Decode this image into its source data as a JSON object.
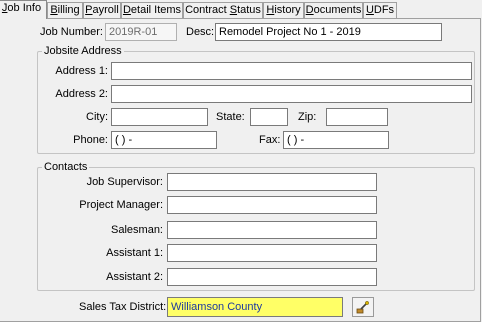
{
  "tabs": [
    {
      "pre": "",
      "key": "J",
      "post": "ob Info",
      "display": "Job Info"
    },
    {
      "pre": "",
      "key": "B",
      "post": "illing"
    },
    {
      "pre": "",
      "key": "P",
      "post": "ayroll"
    },
    {
      "pre": "",
      "key": "D",
      "post": "etail Items"
    },
    {
      "pre": "Contract ",
      "key": "S",
      "post": "tatus"
    },
    {
      "pre": "",
      "key": "H",
      "post": "istory"
    },
    {
      "pre": "",
      "key": "D",
      "post": "ocuments"
    },
    {
      "pre": "",
      "key": "U",
      "post": "DFs"
    }
  ],
  "job": {
    "number_label": "Job Number:",
    "number_value": "2019R-01",
    "desc_label": "Desc:",
    "desc_value": "Remodel Project No 1 - 2019"
  },
  "jobsite": {
    "legend": "Jobsite Address",
    "address1_label": "Address 1:",
    "address2_label": "Address 2:",
    "city_label": "City:",
    "state_label": "State:",
    "zip_label": "Zip:",
    "phone_label": "Phone:",
    "phone_value": "(   )    -",
    "fax_label": "Fax:",
    "fax_value": "(   )    -"
  },
  "contacts": {
    "legend": "Contacts",
    "supervisor_label": "Job Supervisor:",
    "manager_label": "Project Manager:",
    "salesman_label": "Salesman:",
    "assistant1_label": "Assistant 1:",
    "assistant2_label": "Assistant 2:"
  },
  "tax": {
    "label": "Sales Tax District:",
    "value": "Williamson County",
    "highlight_color": "#ffff66",
    "button_icon": "lookup-icon"
  }
}
